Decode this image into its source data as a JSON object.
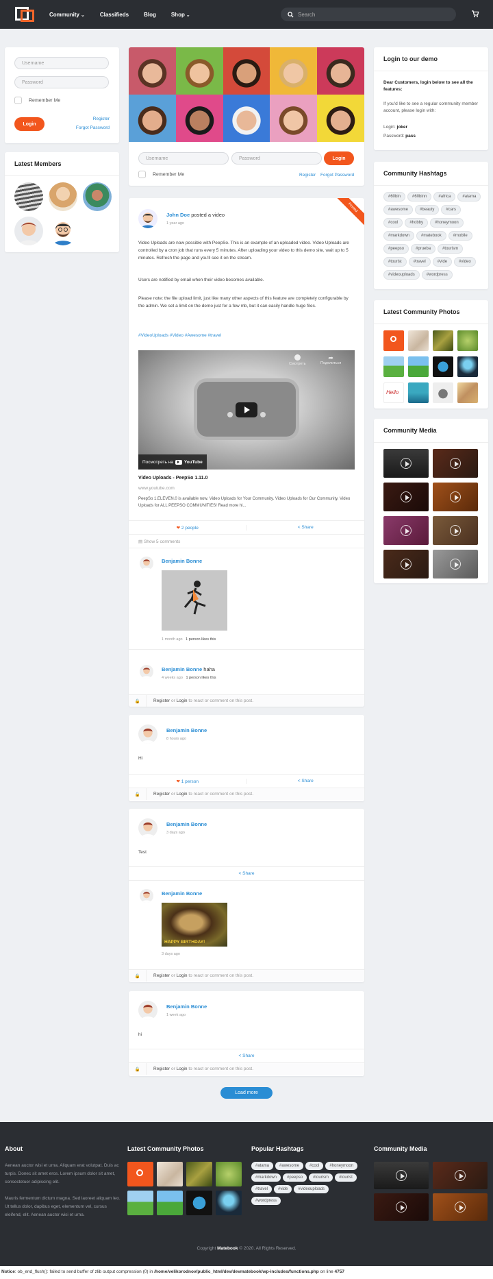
{
  "header": {
    "nav": [
      "Community",
      "Classifieds",
      "Blog",
      "Shop"
    ],
    "search_placeholder": "Search"
  },
  "login_box": {
    "username_placeholder": "Username",
    "password_placeholder": "Password",
    "remember": "Remember Me",
    "login": "Login",
    "register": "Register",
    "forgot": "Forgot Password"
  },
  "latest_members": {
    "title": "Latest Members"
  },
  "demo": {
    "title": "Login to our demo",
    "intro": "Dear Customers, login below to see all the features:",
    "p2": "If you'd like to see a regular community member account, please login with:",
    "login_label": "Login:",
    "login_value": "joker",
    "pass_label": "Password:",
    "pass_value": "pass"
  },
  "hashtags": {
    "title": "Community Hashtags",
    "tags": [
      "#60bin",
      "#60binn",
      "#africa",
      "#atama",
      "#awesome",
      "#beauty",
      "#cars",
      "#cool",
      "#hobby",
      "#honeymoon",
      "#markdown",
      "#matebook",
      "#mobile",
      "#peepso",
      "#prueba",
      "#tourism",
      "#tourist",
      "#travel",
      "#vide",
      "#video",
      "#videouploads",
      "#wordpress"
    ]
  },
  "latest_photos": {
    "title": "Latest Community Photos"
  },
  "community_media": {
    "title": "Community Media"
  },
  "post1": {
    "ribbon": "Pinned",
    "author": "John Doe",
    "action": "posted a video",
    "time": "1 year ago",
    "p1": "Video Uploads are now possible with PeepSo. This is an example of an uploaded video. Video Uploads are controlled by a cron job that runs every 5 minutes. After uploading your video to this demo site, wait up to 5 minutes. Refresh the page and you'll see it on the stream.",
    "p2": "Users are notified by email when their video becomes available.",
    "p3": "Please note: the file upload limit, just like many other aspects of this feature are completely configurable by the admin. We set a limit on the demo just for a few mb, but it can easily handle huge files.",
    "hashtags": "#VideoUploads #Video #Awesome #travel",
    "yt_watch_later": "Смотреть",
    "yt_share": "Поделиться",
    "yt_watch_on": "Посмотреть на",
    "yt_brand": "YouTube",
    "video_title": "Video Uploads - PeepSo 1.11.0",
    "video_url": "www.youtube.com",
    "video_desc": "PeepSo 1.ELEVEN.0 is available now. Video Uploads for Your Community. Video Uploads for Our Community. Video Uploads for ALL PEEPSO COMMUNITIES! Read more hi...",
    "likes": "2 people",
    "share": "Share",
    "show_comments": "Show 5 comments",
    "c1_author": "Benjamin Bonne",
    "c1_time": "1 month ago",
    "c1_likes": "1 person likes this",
    "c2_author": "Benjamin Bonne",
    "c2_text": "haha",
    "c2_time": "4 weeks ago",
    "c2_likes": "1 person likes this"
  },
  "guest": {
    "register": "Register",
    "or": "or",
    "login": "Login",
    "rest": "to react or comment on this post."
  },
  "post2": {
    "author": "Benjamin Bonne",
    "time": "8 hours ago",
    "text": "Hi",
    "likes": "1 person",
    "share": "Share"
  },
  "post3": {
    "author": "Benjamin Bonne",
    "time": "3 days ago",
    "text": "Test",
    "share": "Share",
    "c_author": "Benjamin Bonne",
    "c_time": "3 days ago",
    "c_img_text": "HAPPY BIRTHDAY!"
  },
  "post4": {
    "author": "Benjamin Bonne",
    "time": "1 week ago",
    "text": "hi",
    "share": "Share"
  },
  "load_more": "Load more",
  "footer": {
    "about_title": "About",
    "about_p1": "Aenean auctor wisi et urna. Aliquam erat volutpat. Duis ac turpis. Donec sit amet eros. Lorem ipsum dolor sit amet, consectetuer adipiscing elit.",
    "about_p2": "Mauris fermentum dictum magna. Sed laoreet aliquam leo. Ut tellus dolor, dapibus eget, elementum vel, cursus eleifend, elit. Aenean auctor wisi et urna.",
    "photos_title": "Latest Community Photos",
    "popular_title": "Popular Hashtags",
    "popular_tags": [
      "#atama",
      "#awesome",
      "#cool",
      "#honeymoon",
      "#markdown",
      "#peepso",
      "#tourism",
      "#tourist",
      "#travel",
      "#vide",
      "#videouploads",
      "#wordpress"
    ],
    "media_title": "Community Media",
    "copyright_pre": "Copyright",
    "brand": "Matebook",
    "copyright_post": "© 2020. All Rights Reserved."
  },
  "notice": {
    "label": "Notice",
    "msg": ": ob_end_flush(): failed to send buffer of zlib output compression (0) in",
    "path": "/home/velikorodnov/public_html/dev/devmatebook/wp-includes/functions.php",
    "on": "on line",
    "line": "4757"
  },
  "colors": {
    "accent": "#f2561d",
    "link": "#2a8dd4",
    "header": "#2b2e33"
  }
}
